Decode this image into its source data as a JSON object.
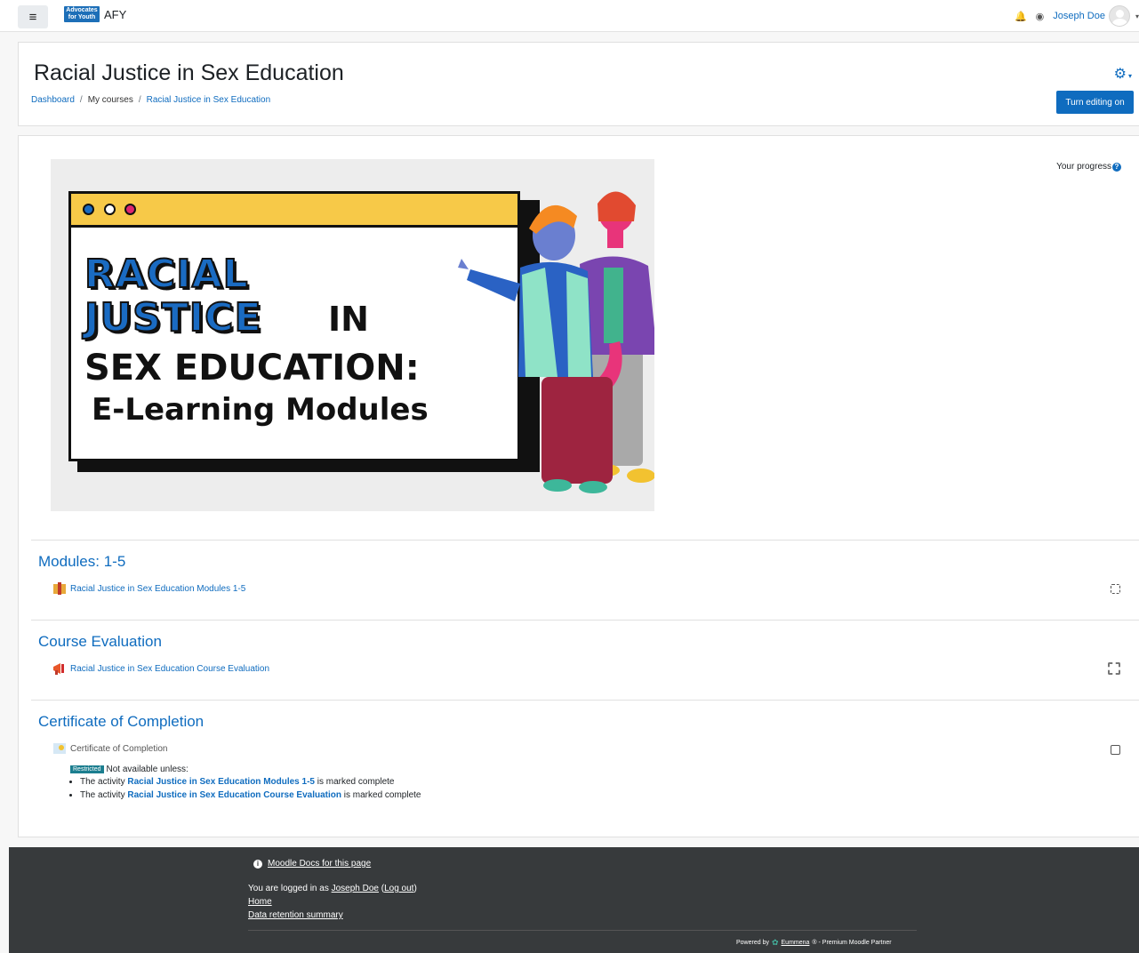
{
  "navbar": {
    "logo_text_1": "Advocates",
    "logo_text_2": "for Youth",
    "site_name": "AFY",
    "user_name": "Joseph Doe",
    "bell_icon": "bell-icon",
    "message_icon": "chat-bubble-icon"
  },
  "header": {
    "title": "Racial Justice in Sex Education",
    "breadcrumb": [
      "Dashboard",
      "My courses",
      "Racial Justice in Sex Education"
    ],
    "edit_button_label": "Turn editing on"
  },
  "progress_label": "Your progress",
  "banner": {
    "line1": "RACIAL",
    "line2": "JUSTICE",
    "line2b": "IN",
    "line3": "SEX EDUCATION:",
    "line4": "E-Learning Modules"
  },
  "sections": [
    {
      "title": "Modules: 1-5",
      "activity": "Racial Justice in Sex Education Modules 1-5"
    },
    {
      "title": "Course Evaluation",
      "activity": "Racial Justice in Sex Education Course Evaluation"
    },
    {
      "title": "Certificate of Completion",
      "activity": "Certificate of Completion",
      "restriction": {
        "badge": "Restricted",
        "intro": "Not available unless:",
        "items": [
          {
            "prefix": "The activity",
            "name": "Racial Justice in Sex Education Modules 1-5",
            "suffix": "is marked complete"
          },
          {
            "prefix": "The activity",
            "name": "Racial Justice in Sex Education Course Evaluation",
            "suffix": "is marked complete"
          }
        ]
      }
    }
  ],
  "footer": {
    "docs_link": "Moodle Docs for this page",
    "logged_in_prefix": "You are logged in as",
    "user_name": "Joseph Doe",
    "logout": "Log out",
    "home": "Home",
    "data_retention": "Data retention summary",
    "powered_by": "Powered by",
    "partner_name": "Eummena",
    "partner_suffix": "® - Premium Moodle Partner"
  }
}
